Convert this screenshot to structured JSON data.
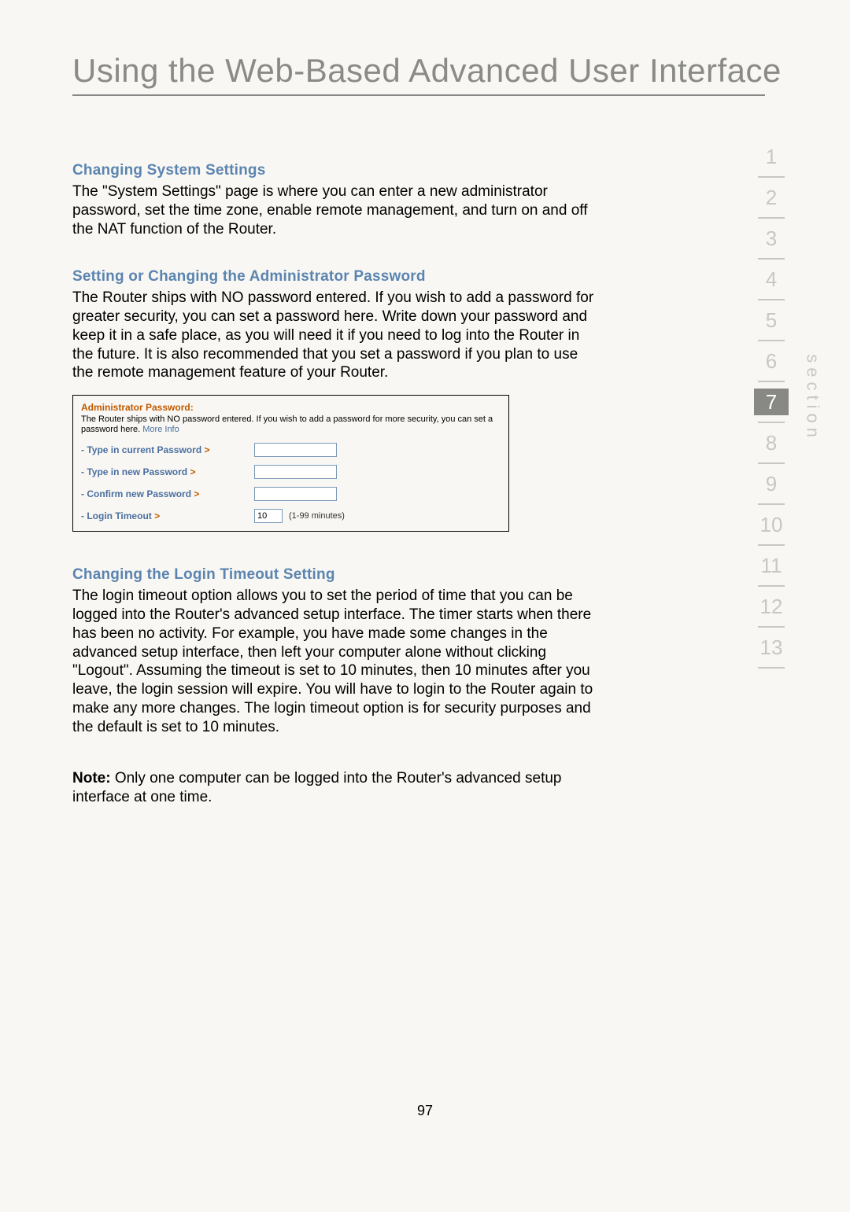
{
  "page_title": "Using the Web-Based Advanced User Interface",
  "sections": {
    "s1": {
      "heading": "Changing System Settings",
      "body": "The \"System Settings\" page is where you can enter a new administrator password, set the time zone, enable remote management, and turn on and off the NAT function of the Router."
    },
    "s2": {
      "heading": "Setting or Changing the Administrator Password",
      "body": "The Router ships with NO password entered. If you wish to add a password for greater security, you can set a password here. Write down your password and keep it in a safe place, as you will need it if you need to log into the Router in the future. It is also recommended that you set a password if you plan to use the remote management feature of your Router."
    },
    "s3": {
      "heading": "Changing the Login Timeout Setting",
      "body": "The login timeout option allows you to set the period of time that you can be logged into the Router's advanced setup interface. The timer starts when there has been no activity. For example, you have made some changes in the advanced setup interface, then left your computer alone without clicking \"Logout\". Assuming the timeout is set to 10 minutes, then 10 minutes after you leave, the login session will expire. You will have to login to the Router again to make any more changes. The login timeout option is for security purposes and the default is set to 10 minutes."
    }
  },
  "note": {
    "label": "Note:",
    "text": " Only one computer can be logged into the Router's advanced setup interface at one time."
  },
  "screenshot": {
    "title": "Administrator Password:",
    "desc": "The Router ships with NO password entered. If you wish to add a password for more security, you can set a password here. ",
    "more_info": "More Info",
    "rows": {
      "current": "- Type in current Password",
      "new": "- Type in new Password",
      "confirm": "- Confirm new Password",
      "timeout": "- Login Timeout"
    },
    "arrow": ">",
    "timeout_value": "10",
    "timeout_hint": "(1-99 minutes)"
  },
  "nav": {
    "items": [
      "1",
      "2",
      "3",
      "4",
      "5",
      "6",
      "7",
      "8",
      "9",
      "10",
      "11",
      "12",
      "13"
    ],
    "active_index": 6,
    "label": "section"
  },
  "page_number": "97"
}
